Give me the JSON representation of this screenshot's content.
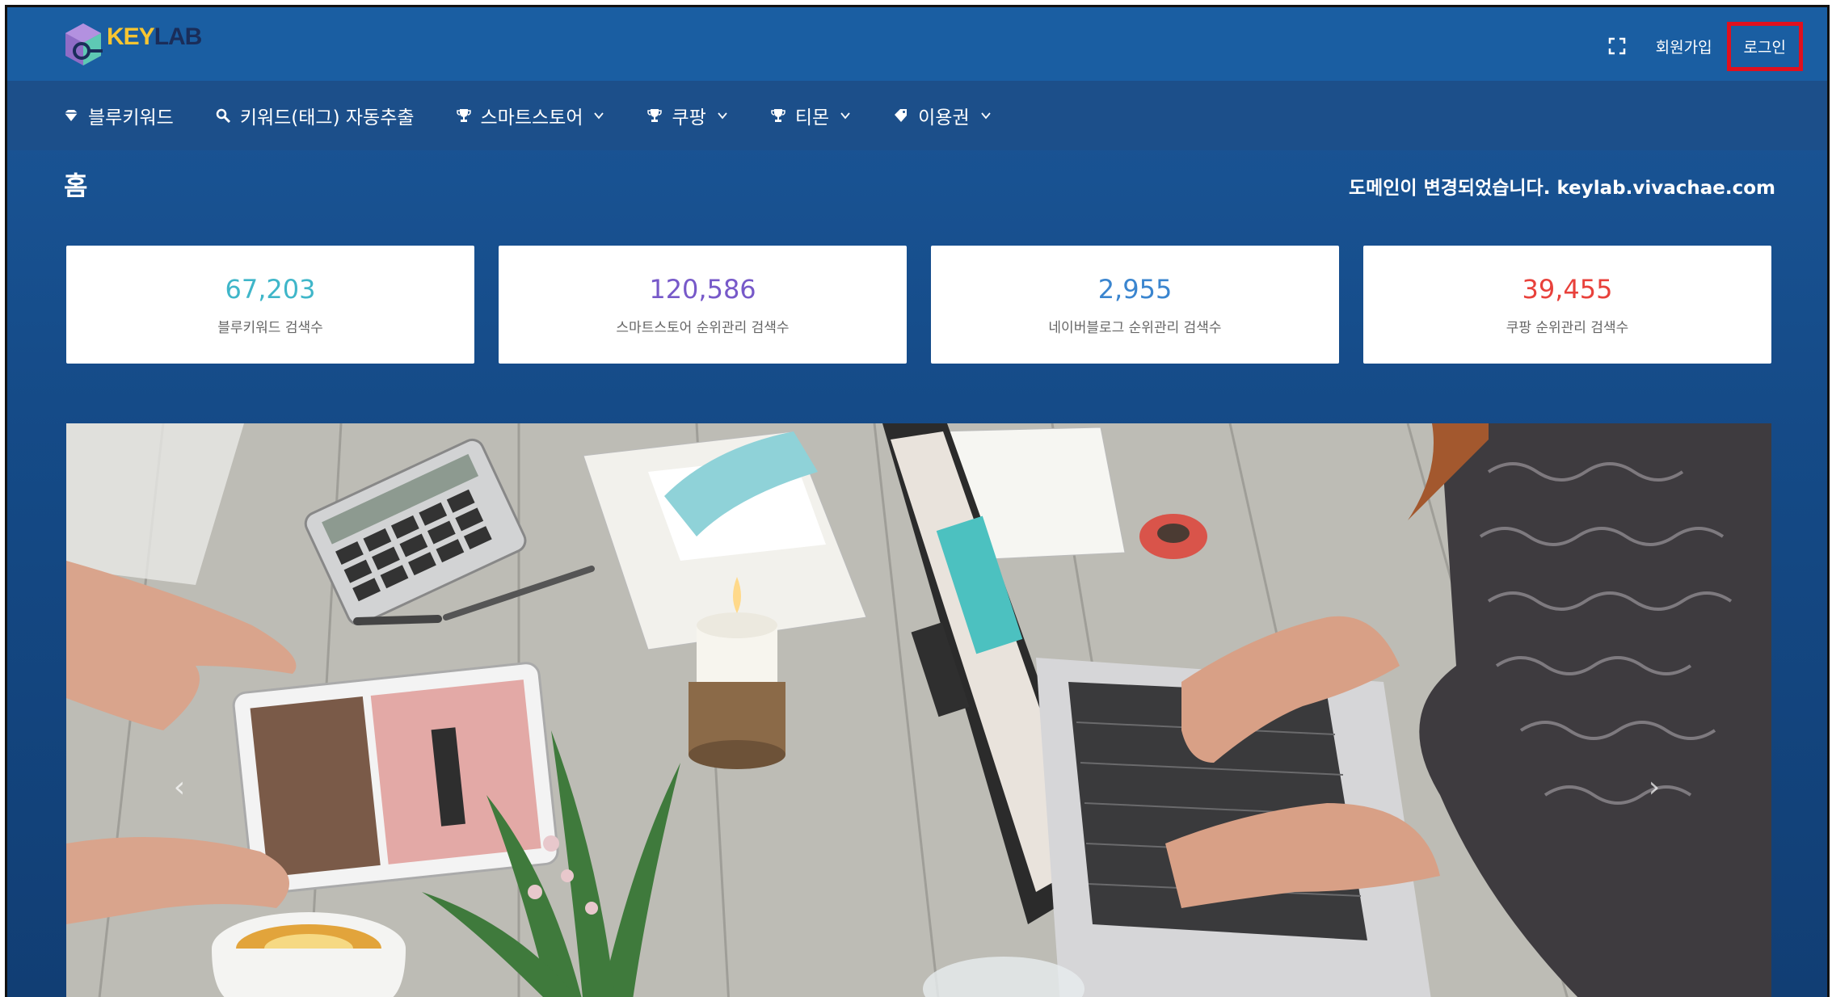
{
  "header": {
    "logo_text_a": "KEY",
    "logo_text_b": "LAB",
    "signup_label": "회원가입",
    "login_label": "로그인"
  },
  "nav": {
    "items": [
      {
        "label": "블루키워드",
        "icon": "diamond-icon"
      },
      {
        "label": "키워드(태그) 자동추출",
        "icon": "search-icon"
      },
      {
        "label": "스마트스토어",
        "icon": "trophy-icon"
      },
      {
        "label": "쿠팡",
        "icon": "trophy-icon"
      },
      {
        "label": "티몬",
        "icon": "trophy-icon"
      },
      {
        "label": "이용권",
        "icon": "tag-icon"
      }
    ]
  },
  "page": {
    "title": "홈",
    "notice": "도메인이 변경되었습니다. keylab.vivachae.com"
  },
  "stats": [
    {
      "value": "67,203",
      "label": "블루키워드 검색수",
      "color": "#3fb6c9"
    },
    {
      "value": "120,586",
      "label": "스마트스토어 순위관리 검색수",
      "color": "#7759c9"
    },
    {
      "value": "2,955",
      "label": "네이버블로그 순위관리 검색수",
      "color": "#3a85cf"
    },
    {
      "value": "39,455",
      "label": "쿠팡 순위관리 검색수",
      "color": "#e8413b"
    }
  ],
  "colors": {
    "header_bg": "#1a5ea2",
    "nav_bg": "#1c4f8a",
    "login_highlight": "#e0101e"
  }
}
